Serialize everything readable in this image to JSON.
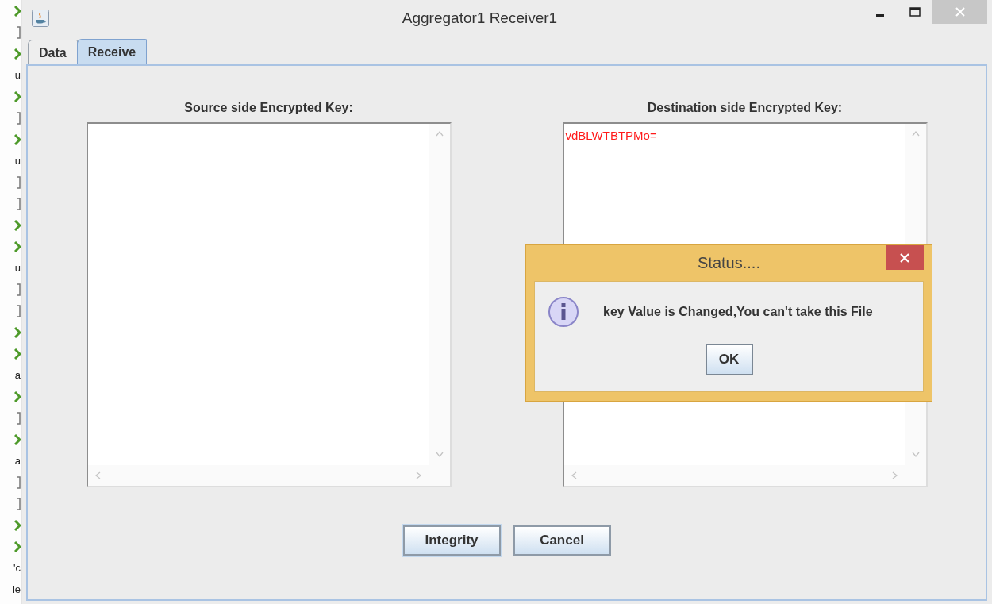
{
  "background_strip": [
    {
      "kind": "arrow"
    },
    {
      "kind": "bracket"
    },
    {
      "kind": "arrow"
    },
    {
      "kind": "text",
      "text": "u"
    },
    {
      "kind": "arrow"
    },
    {
      "kind": "bracket"
    },
    {
      "kind": "arrow"
    },
    {
      "kind": "text",
      "text": "u"
    },
    {
      "kind": "bracket"
    },
    {
      "kind": "bracket"
    },
    {
      "kind": "arrow"
    },
    {
      "kind": "arrow"
    },
    {
      "kind": "text",
      "text": "u"
    },
    {
      "kind": "bracket"
    },
    {
      "kind": "bracket"
    },
    {
      "kind": "arrow"
    },
    {
      "kind": "arrow"
    },
    {
      "kind": "text",
      "text": "a"
    },
    {
      "kind": "arrow"
    },
    {
      "kind": "bracket"
    },
    {
      "kind": "arrow"
    },
    {
      "kind": "text",
      "text": "a"
    },
    {
      "kind": "bracket"
    },
    {
      "kind": "bracket"
    },
    {
      "kind": "arrow"
    },
    {
      "kind": "arrow"
    },
    {
      "kind": "text",
      "text": "'c"
    },
    {
      "kind": "text",
      "text": "ie"
    }
  ],
  "window": {
    "title": "Aggregator1 Receiver1"
  },
  "tabs": [
    {
      "label": "Data",
      "selected": false
    },
    {
      "label": "Receive",
      "selected": true
    }
  ],
  "panes": [
    {
      "label": "Source side Encrypted Key:"
    },
    {
      "label": "Destination side Encrypted Key:",
      "value": "vdBLWTBTPMo="
    }
  ],
  "buttons": [
    {
      "label": "Integrity",
      "focused": true
    },
    {
      "label": "Cancel",
      "focused": false
    }
  ],
  "dialog": {
    "title": "Status....",
    "message": "key Value is Changed,You can't take this File",
    "button": "OK"
  }
}
